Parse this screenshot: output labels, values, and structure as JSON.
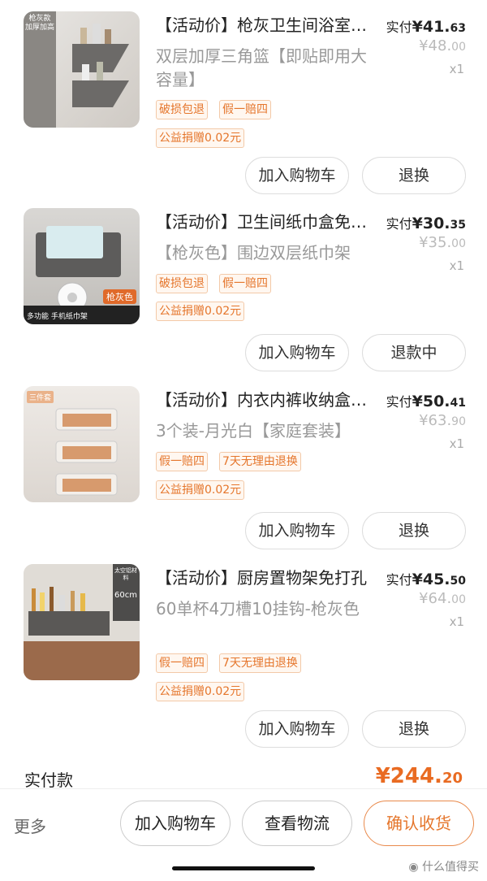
{
  "items": [
    {
      "title": "【活动价】枪灰卫生间浴室置物架",
      "spec": "双层加厚三角篮【即贴即用大容量】",
      "tags": [
        "破损包退",
        "假一赔四"
      ],
      "charity": "公益捐赠0.02元",
      "paid_label": "实付",
      "paid_int": "¥41.",
      "paid_dec": "63",
      "orig_int": "¥48.",
      "orig_dec": "00",
      "qty": "x1",
      "btn_add": "加入购物车",
      "btn_ret": "退换",
      "thumb_text": [
        "枪灰款",
        "加厚加高"
      ]
    },
    {
      "title": "【活动价】卫生间纸巾盒免打孔",
      "spec": "【枪灰色】围边双层纸巾架",
      "tags": [
        "破损包退",
        "假一赔四"
      ],
      "charity": "公益捐赠0.02元",
      "paid_label": "实付",
      "paid_int": "¥30.",
      "paid_dec": "35",
      "orig_int": "¥35.",
      "orig_dec": "00",
      "qty": "x1",
      "btn_add": "加入购物车",
      "btn_ret": "退款中",
      "thumb_text": [
        "枪灰色",
        "多功能 手机纸巾架"
      ]
    },
    {
      "title": "【活动价】内衣内裤收纳盒壁挂",
      "spec": "3个装-月光白【家庭套装】",
      "tags": [
        "假一赔四",
        "7天无理由退换"
      ],
      "charity": "公益捐赠0.02元",
      "paid_label": "实付",
      "paid_int": "¥50.",
      "paid_dec": "41",
      "orig_int": "¥63.",
      "orig_dec": "90",
      "qty": "x1",
      "btn_add": "加入购物车",
      "btn_ret": "退换",
      "thumb_text": [
        "三件套"
      ]
    },
    {
      "title": "【活动价】厨房置物架免打孔",
      "spec": "60单杯4刀槽10挂钩-枪灰色",
      "tags": [
        "假一赔四",
        "7天无理由退换"
      ],
      "charity": "公益捐赠0.02元",
      "paid_label": "实付",
      "paid_int": "¥45.",
      "paid_dec": "50",
      "orig_int": "¥64.",
      "orig_dec": "00",
      "qty": "x1",
      "btn_add": "加入购物车",
      "btn_ret": "退换",
      "thumb_text": [
        "太空铝材料",
        "60cm"
      ]
    }
  ],
  "total": {
    "label": "实付款",
    "int": "¥244.",
    "dec": "20"
  },
  "bottom": {
    "more": "更多",
    "add_cart": "加入购物车",
    "logistics": "查看物流",
    "confirm": "确认收货"
  },
  "watermark": "什么值得买",
  "colors": {
    "accent": "#e5762c",
    "price_total": "#e96b22"
  }
}
